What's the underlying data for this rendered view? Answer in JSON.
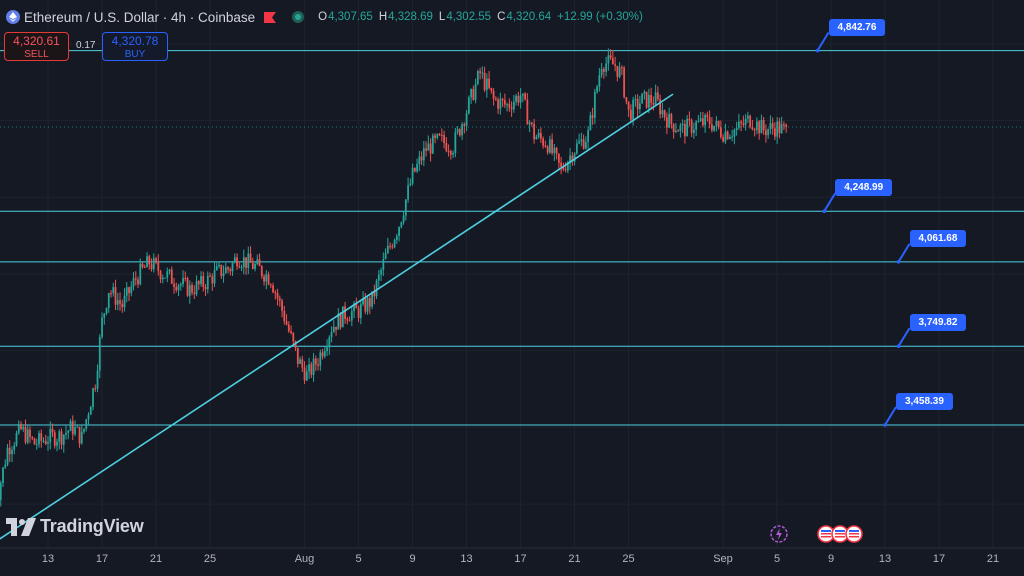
{
  "header": {
    "symbol_title": "Ethereum / U.S. Dollar · 4h · Coinbase",
    "ohlc": [
      {
        "label": "O",
        "value": "4,307.65"
      },
      {
        "label": "H",
        "value": "4,328.69"
      },
      {
        "label": "L",
        "value": "4,302.55"
      },
      {
        "label": "C",
        "value": "4,320.64"
      },
      {
        "label": "",
        "value": "+12.99 (+0.30%)"
      }
    ]
  },
  "trade": {
    "sell_price": "4,320.61",
    "sell_label": "SELL",
    "spread": "0.17",
    "buy_price": "4,320.78",
    "buy_label": "BUY"
  },
  "branding": {
    "logo_text": "TradingView"
  },
  "colors": {
    "background": "#151924",
    "up": "#26a69a",
    "down": "#ef5350",
    "line": "#4dd0e1",
    "callout": "#2962ff"
  },
  "chart_data": {
    "type": "candlestick",
    "title": "Ethereum / U.S. Dollar · 4h · Coinbase",
    "ylim": [
      2900,
      5030
    ],
    "x_ticks": [
      {
        "day": 13,
        "label": "13"
      },
      {
        "day": 17,
        "label": "17"
      },
      {
        "day": 21,
        "label": "21"
      },
      {
        "day": 25,
        "label": "25"
      },
      {
        "day": 32,
        "label": "Aug"
      },
      {
        "day": 36,
        "label": "5"
      },
      {
        "day": 40,
        "label": "9"
      },
      {
        "day": 44,
        "label": "13"
      },
      {
        "day": 48,
        "label": "17"
      },
      {
        "day": 52,
        "label": "21"
      },
      {
        "day": 56,
        "label": "25"
      },
      {
        "day": 63,
        "label": "Sep"
      },
      {
        "day": 67,
        "label": "5"
      },
      {
        "day": 71,
        "label": "9"
      },
      {
        "day": 75,
        "label": "13"
      },
      {
        "day": 79,
        "label": "17"
      },
      {
        "day": 83,
        "label": "21"
      }
    ],
    "price_levels": [
      {
        "value": 4842.76,
        "label": "4,842.76"
      },
      {
        "value": 4248.99,
        "label": "4,248.99"
      },
      {
        "value": 4061.68,
        "label": "4,061.68"
      },
      {
        "value": 3749.82,
        "label": "3,749.82"
      },
      {
        "value": 3458.39,
        "label": "3,458.39"
      }
    ],
    "callouts": [
      {
        "label": "4,842.76",
        "day": 70,
        "price": 4842.76
      },
      {
        "label": "4,248.99",
        "day": 70.5,
        "price": 4248.99
      },
      {
        "label": "4,061.68",
        "day": 76,
        "price": 4061.68
      },
      {
        "label": "3,749.82",
        "day": 76,
        "price": 3749.82
      },
      {
        "label": "3,458.39",
        "day": 75,
        "price": 3458.39
      }
    ],
    "trendlines": [
      {
        "from": {
          "day": 8.3,
          "price": 3000
        },
        "to": {
          "day": 59.3,
          "price": 4682
        }
      }
    ],
    "path": [
      [
        9.0,
        3130
      ],
      [
        10.0,
        3370
      ],
      [
        11.0,
        3440
      ],
      [
        12.0,
        3390
      ],
      [
        13.0,
        3410
      ],
      [
        14.0,
        3420
      ],
      [
        14.8,
        3450
      ],
      [
        15.5,
        3410
      ],
      [
        16.5,
        3620
      ],
      [
        17.0,
        3840
      ],
      [
        17.5,
        3960
      ],
      [
        18.5,
        3900
      ],
      [
        19.5,
        4000
      ],
      [
        20.5,
        4060
      ],
      [
        21.5,
        4020
      ],
      [
        22.5,
        3990
      ],
      [
        23.5,
        3960
      ],
      [
        24.5,
        3980
      ],
      [
        25.5,
        4020
      ],
      [
        26.5,
        4040
      ],
      [
        27.0,
        4080
      ],
      [
        28.5,
        4040
      ],
      [
        29.5,
        4000
      ],
      [
        30.5,
        3860
      ],
      [
        31.5,
        3700
      ],
      [
        32.2,
        3640
      ],
      [
        33.0,
        3700
      ],
      [
        34.0,
        3820
      ],
      [
        35.0,
        3870
      ],
      [
        36.0,
        3880
      ],
      [
        37.0,
        3920
      ],
      [
        38.0,
        4080
      ],
      [
        39.0,
        4200
      ],
      [
        40.0,
        4380
      ],
      [
        41.0,
        4480
      ],
      [
        42.0,
        4510
      ],
      [
        43.0,
        4490
      ],
      [
        44.0,
        4620
      ],
      [
        45.0,
        4760
      ],
      [
        46.0,
        4660
      ],
      [
        47.0,
        4640
      ],
      [
        48.0,
        4680
      ],
      [
        49.0,
        4530
      ],
      [
        50.0,
        4500
      ],
      [
        51.0,
        4400
      ],
      [
        52.0,
        4480
      ],
      [
        53.0,
        4530
      ],
      [
        54.0,
        4800
      ],
      [
        55.0,
        4790
      ],
      [
        55.5,
        4750
      ],
      [
        56.0,
        4610
      ],
      [
        57.0,
        4660
      ],
      [
        58.0,
        4660
      ],
      [
        59.0,
        4580
      ],
      [
        60.0,
        4550
      ],
      [
        61.0,
        4570
      ],
      [
        62.0,
        4580
      ],
      [
        63.0,
        4540
      ],
      [
        64.0,
        4550
      ],
      [
        65.0,
        4590
      ],
      [
        66.0,
        4550
      ],
      [
        67.0,
        4560
      ],
      [
        67.8,
        4540
      ]
    ]
  }
}
